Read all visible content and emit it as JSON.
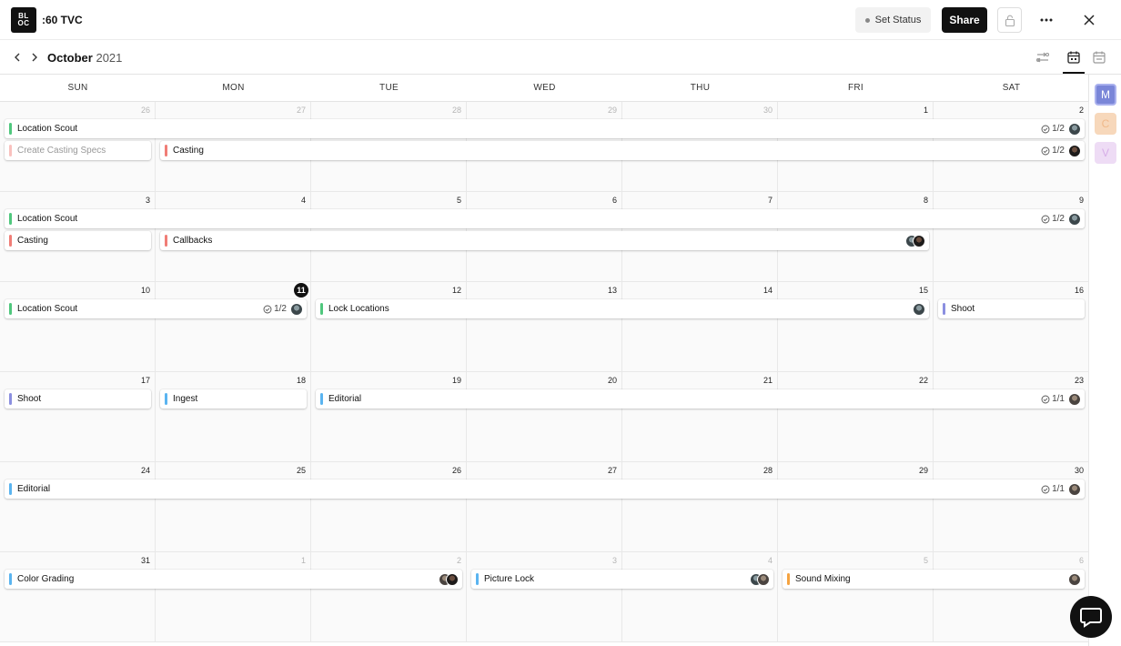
{
  "app": {
    "logo_text_top": "BL",
    "logo_text_bottom": "OC",
    "project_title": ":60 TVC"
  },
  "toolbar": {
    "set_status_label": "Set Status",
    "share_label": "Share"
  },
  "calendar": {
    "month": "October",
    "year": "2021",
    "weekdays": [
      "SUN",
      "MON",
      "TUE",
      "WED",
      "THU",
      "FRI",
      "SAT"
    ],
    "weeks": [
      [
        "26",
        "27",
        "28",
        "29",
        "30",
        "1",
        "2"
      ],
      [
        "3",
        "4",
        "5",
        "6",
        "7",
        "8",
        "9"
      ],
      [
        "10",
        "11",
        "12",
        "13",
        "14",
        "15",
        "16"
      ],
      [
        "17",
        "18",
        "19",
        "20",
        "21",
        "22",
        "23"
      ],
      [
        "24",
        "25",
        "26",
        "27",
        "28",
        "29",
        "30"
      ],
      [
        "31",
        "1",
        "2",
        "3",
        "4",
        "5",
        "6"
      ]
    ],
    "today": "11"
  },
  "events": [
    {
      "id": "e1",
      "label": "Location Scout",
      "color": "#4fc77d",
      "check": "1/2"
    },
    {
      "id": "e2",
      "label": "Create Casting Specs",
      "color": "#f6a7a2"
    },
    {
      "id": "e3",
      "label": "Casting",
      "color": "#f07d76",
      "check": "1/2"
    },
    {
      "id": "e4",
      "label": "Location Scout",
      "color": "#4fc77d",
      "check": "1/2"
    },
    {
      "id": "e5",
      "label": "Casting",
      "color": "#f07d76"
    },
    {
      "id": "e6",
      "label": "Callbacks",
      "color": "#f07d76"
    },
    {
      "id": "e7",
      "label": "Location Scout",
      "color": "#4fc77d",
      "check": "1/2"
    },
    {
      "id": "e8",
      "label": "Lock Locations",
      "color": "#4fc77d"
    },
    {
      "id": "e9",
      "label": "Shoot",
      "color": "#8b8fe0"
    },
    {
      "id": "e10",
      "label": "Shoot",
      "color": "#8b8fe0"
    },
    {
      "id": "e11",
      "label": "Ingest",
      "color": "#5ab4f0"
    },
    {
      "id": "e12",
      "label": "Editorial",
      "color": "#5ab4f0",
      "check": "1/1"
    },
    {
      "id": "e13",
      "label": "Editorial",
      "color": "#5ab4f0",
      "check": "1/1"
    },
    {
      "id": "e14",
      "label": "Color Grading",
      "color": "#5ab4f0"
    },
    {
      "id": "e15",
      "label": "Picture Lock",
      "color": "#5ab4f0"
    },
    {
      "id": "e16",
      "label": "Sound Mixing",
      "color": "#f5a340"
    }
  ],
  "members": [
    "M",
    "C",
    "V"
  ]
}
